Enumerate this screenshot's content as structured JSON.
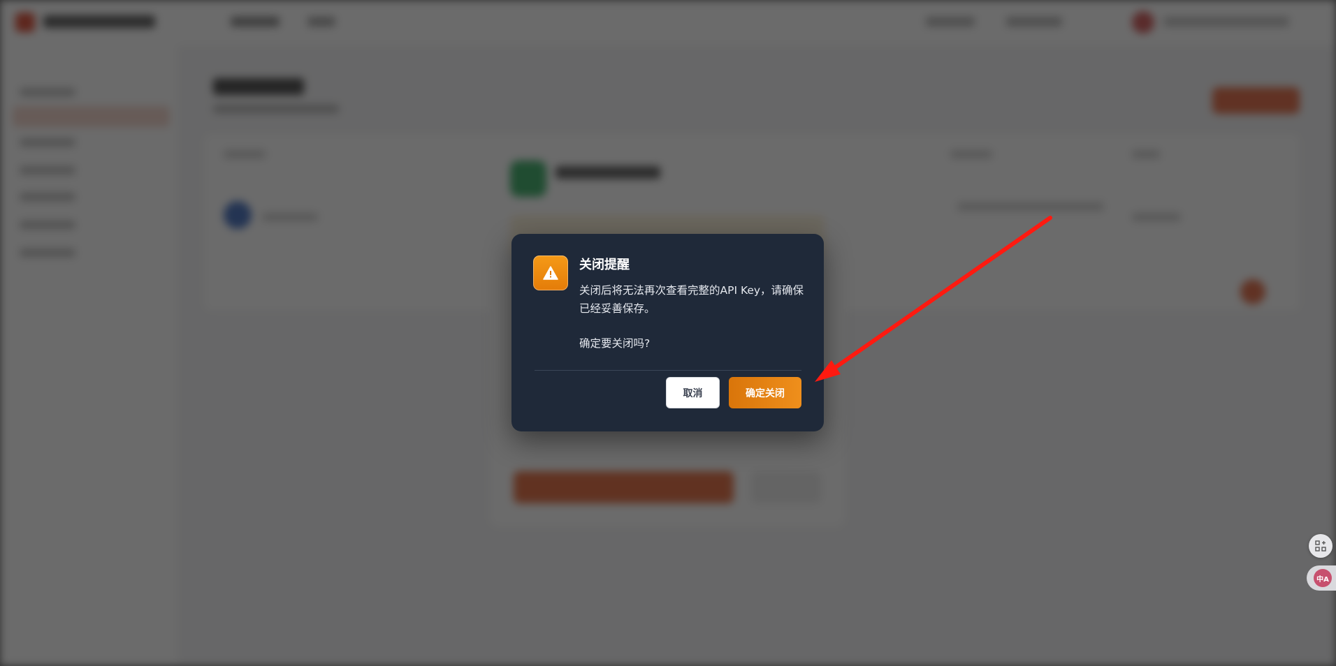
{
  "dialog": {
    "title": "关闭提醒",
    "message_line1": "关闭后将无法再次查看完整的API Key，请确保已经妥善保存。",
    "message_line2": "确定要关闭吗?",
    "cancel_label": "取消",
    "confirm_label": "确定关闭",
    "icon": "warning-triangle-icon"
  },
  "widgets": {
    "apps_icon": "apps-grid-icon",
    "translate_label": "中A"
  },
  "colors": {
    "dialog_bg": "#1f2939",
    "accent_orange": "#e47c09",
    "annotation_red": "#ff1a10"
  }
}
